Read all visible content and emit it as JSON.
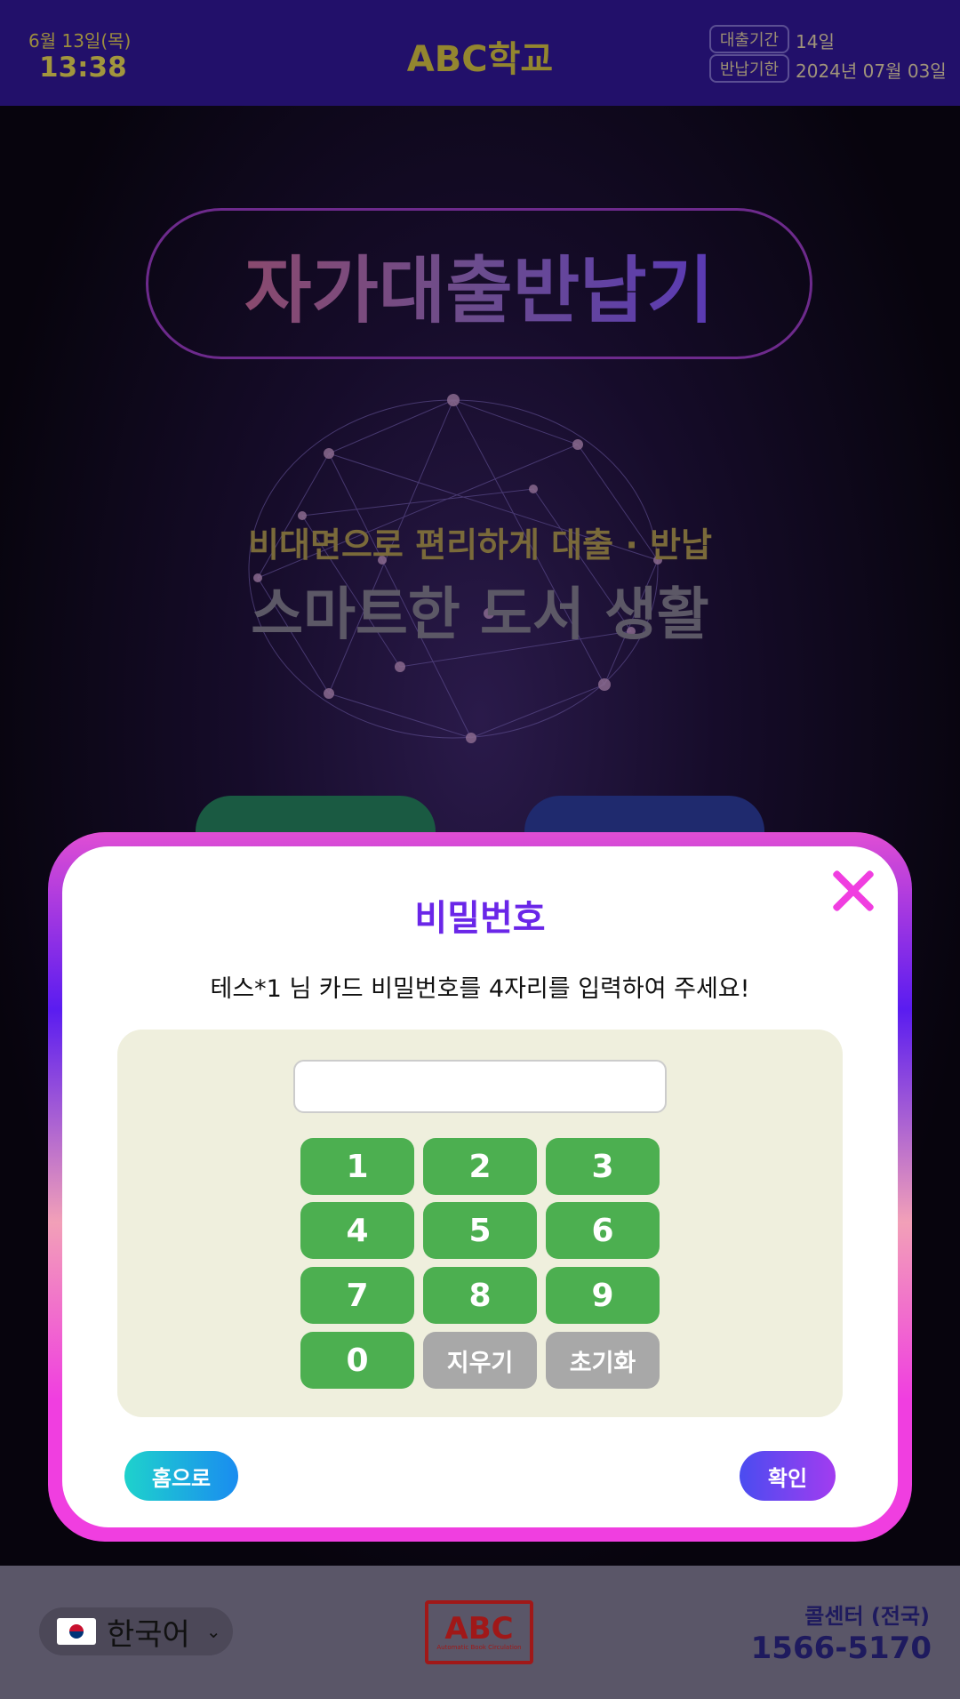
{
  "header": {
    "date": "6월 13일(목)",
    "time": "13:38",
    "school": "ABC학교",
    "loan_period_label": "대출기간",
    "loan_period_value": "14일",
    "return_due_label": "반납기한",
    "return_due_value": "2024년 07월 03일"
  },
  "background": {
    "kiosk_title": "자가대출반납기",
    "tagline": "비대면으로 편리하게 대출 · 반납",
    "headline": "스마트한 도서 생활"
  },
  "modal": {
    "title": "비밀번호",
    "message": "테스*1 님 카드 비밀번호를 4자리를 입력하여 주세요!",
    "password_value": "",
    "keys": [
      "1",
      "2",
      "3",
      "4",
      "5",
      "6",
      "7",
      "8",
      "9",
      "0",
      "지우기",
      "초기화"
    ],
    "home_label": "홈으로",
    "confirm_label": "확인"
  },
  "footer": {
    "language": "한국어",
    "logo_text": "ABC",
    "logo_sub": "Automatic Book Circulation",
    "call_center_label": "콜센터 (전국)",
    "call_center_number": "1566-5170"
  },
  "colors": {
    "header_bg": "#22106a",
    "accent_purple": "#6a26e8",
    "keypad_green": "#4caf50",
    "keypad_gray": "#a8a8a8",
    "close_magenta": "#f03ee0"
  },
  "icons": [
    "close-icon",
    "korea-flag-icon",
    "chevron-down-icon"
  ]
}
